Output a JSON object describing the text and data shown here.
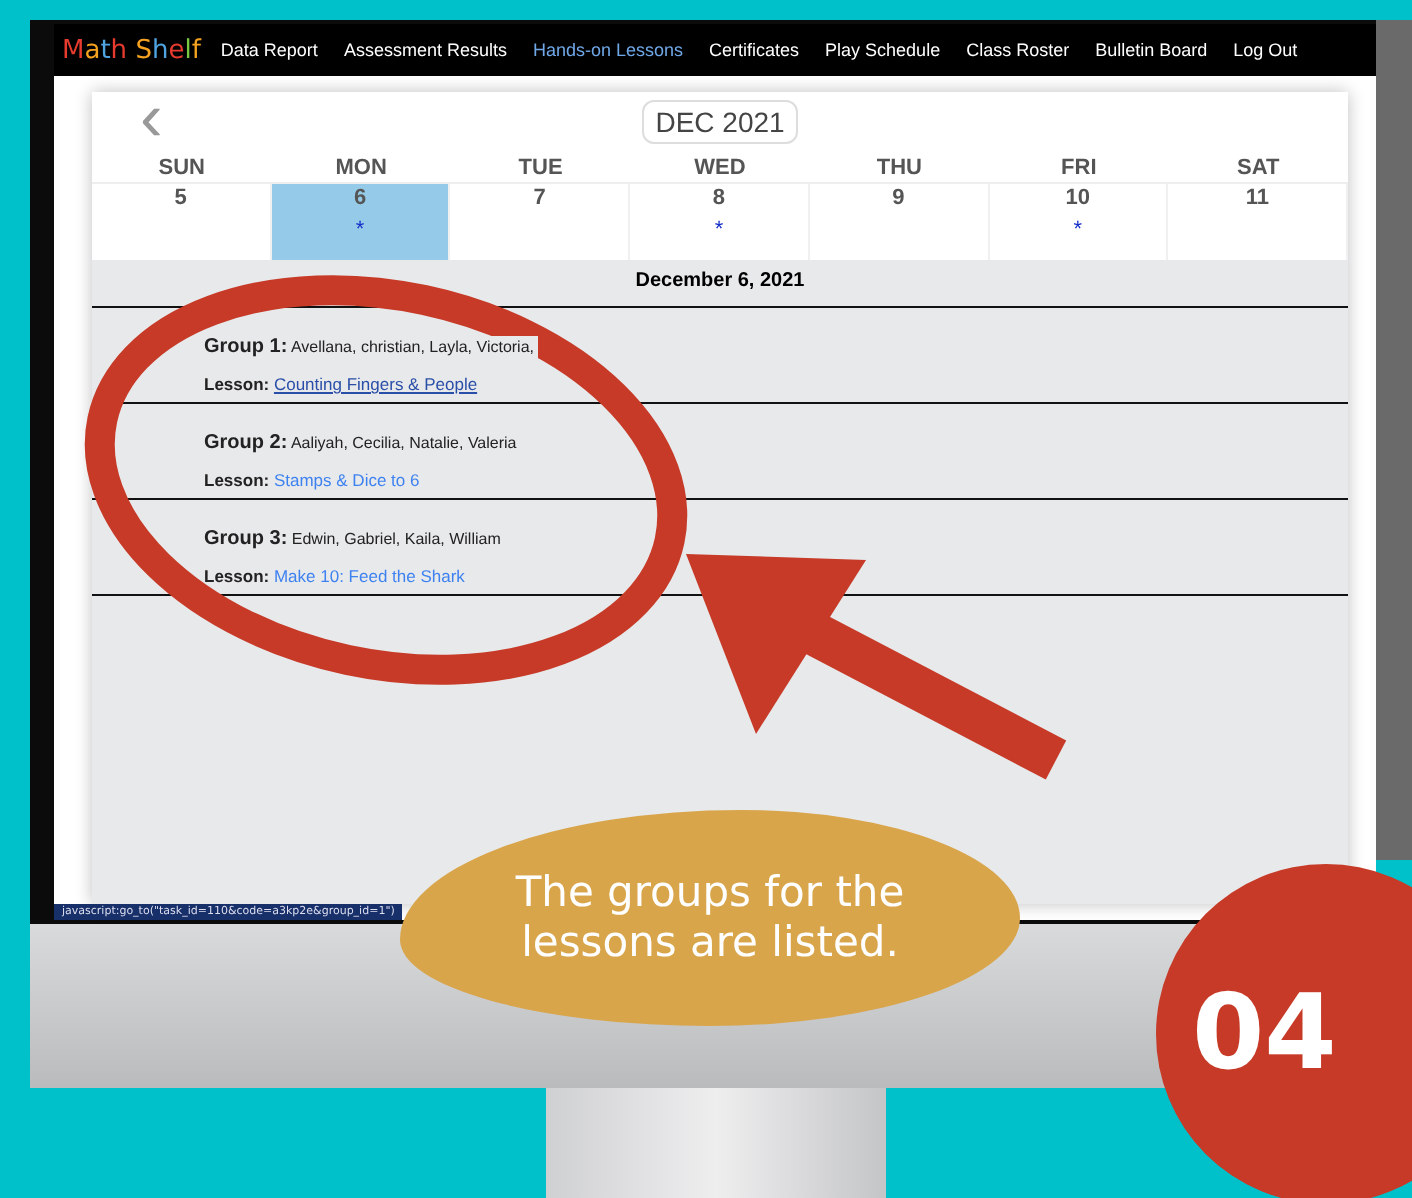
{
  "nav": {
    "logo": "Math Shelf",
    "items": [
      {
        "label": "Data Report",
        "selected": false
      },
      {
        "label": "Assessment Results",
        "selected": false
      },
      {
        "label": "Hands-on Lessons",
        "selected": true
      },
      {
        "label": "Certificates",
        "selected": false
      },
      {
        "label": "Play Schedule",
        "selected": false
      },
      {
        "label": "Class Roster",
        "selected": false
      },
      {
        "label": "Bulletin Board",
        "selected": false
      },
      {
        "label": "Log Out",
        "selected": false
      }
    ]
  },
  "calendar": {
    "month": "DEC 2021",
    "prev": "‹",
    "days": [
      {
        "weekday": "SUN",
        "date": "5",
        "selected": false,
        "marked": false
      },
      {
        "weekday": "MON",
        "date": "6",
        "selected": true,
        "marked": true
      },
      {
        "weekday": "TUE",
        "date": "7",
        "selected": false,
        "marked": false
      },
      {
        "weekday": "WED",
        "date": "8",
        "selected": false,
        "marked": true
      },
      {
        "weekday": "THU",
        "date": "9",
        "selected": false,
        "marked": false
      },
      {
        "weekday": "FRI",
        "date": "10",
        "selected": false,
        "marked": true
      },
      {
        "weekday": "SAT",
        "date": "11",
        "selected": false,
        "marked": false
      }
    ],
    "mark": "*",
    "date_heading": "December 6, 2021",
    "groups": [
      {
        "label": "Group 1:",
        "names": "Avellana, christian, Layla, Victoria,",
        "lesson_label": "Lesson:",
        "lesson": "Counting Fingers & People",
        "hovered": true
      },
      {
        "label": "Group 2:",
        "names": "Aaliyah, Cecilia, Natalie, Valeria",
        "lesson_label": "Lesson:",
        "lesson": "Stamps & Dice to 6",
        "hovered": false
      },
      {
        "label": "Group 3:",
        "names": "Edwin, Gabriel, Kaila, William",
        "lesson_label": "Lesson:",
        "lesson": "Make 10: Feed the Shark",
        "hovered": false
      }
    ]
  },
  "status_bar": "javascript:go_to(\"task_id=110&code=a3kp2e&group_id=1\")",
  "caption": "The groups for the lessons are listed.",
  "step": "04"
}
